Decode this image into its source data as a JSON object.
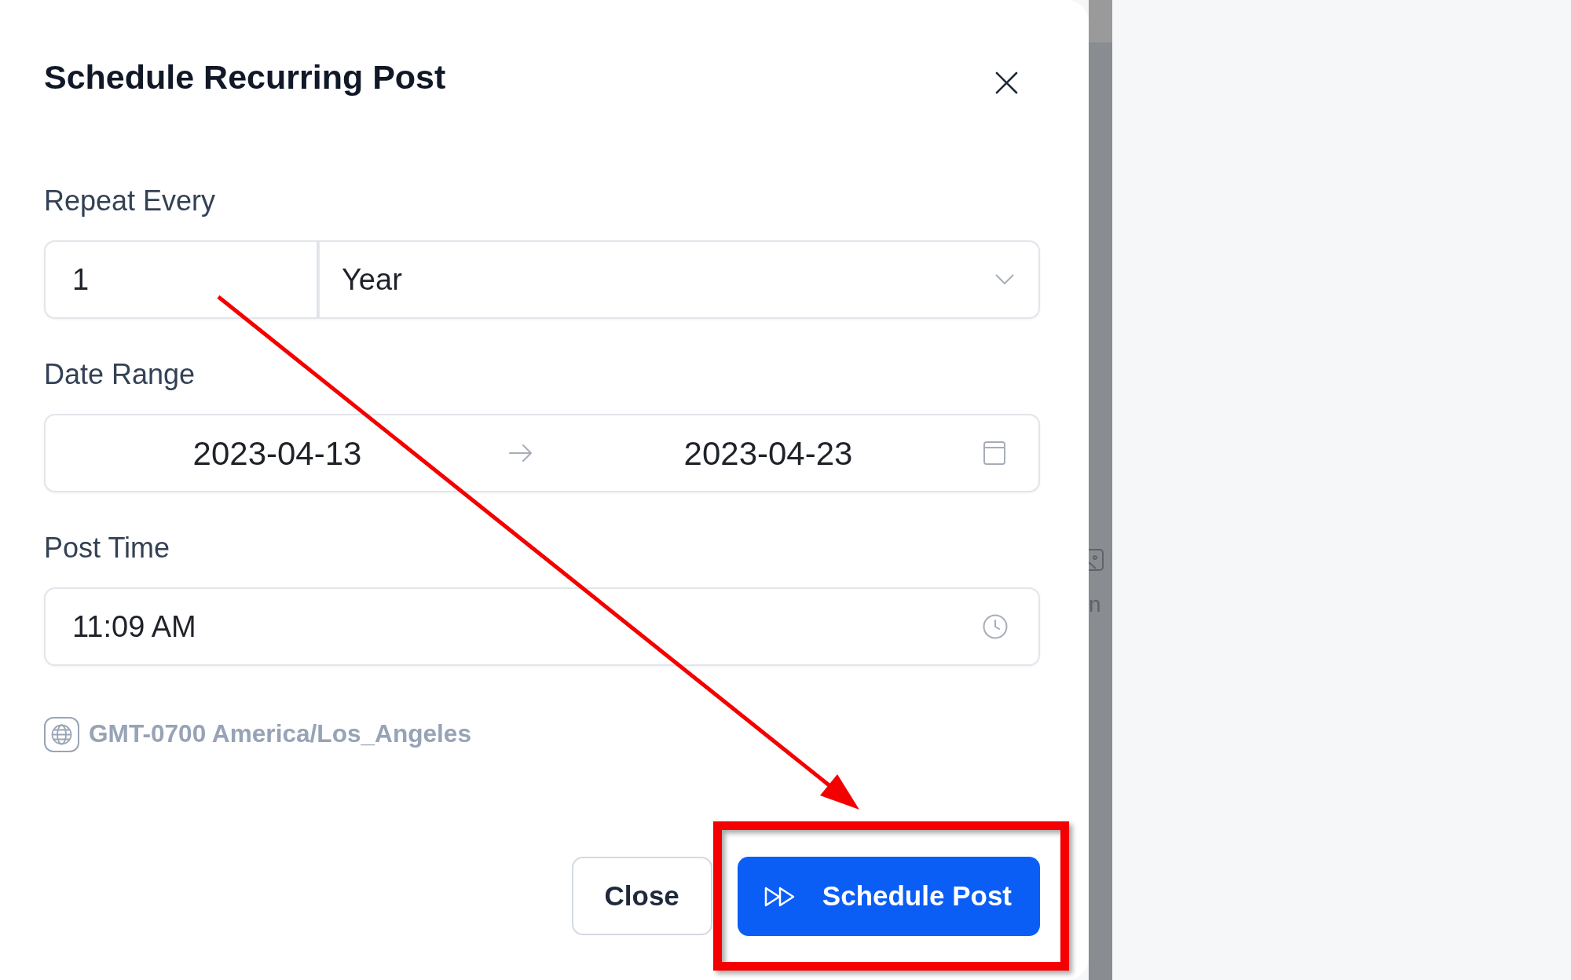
{
  "dialog": {
    "title": "Schedule Recurring Post"
  },
  "form": {
    "repeat": {
      "label": "Repeat Every",
      "count": "1",
      "unit": "Year"
    },
    "date_range": {
      "label": "Date Range",
      "start": "2023-04-13",
      "end": "2023-04-23"
    },
    "post_time": {
      "label": "Post Time",
      "value": "11:09 AM"
    },
    "timezone": "GMT-0700 America/Los_Angeles"
  },
  "actions": [
    {
      "label": "Close",
      "kind": "secondary"
    },
    {
      "label": "Schedule Post",
      "kind": "primary"
    }
  ],
  "background": {
    "text": "n"
  },
  "annotations": {
    "arrow": true,
    "highlight_frame": true
  }
}
